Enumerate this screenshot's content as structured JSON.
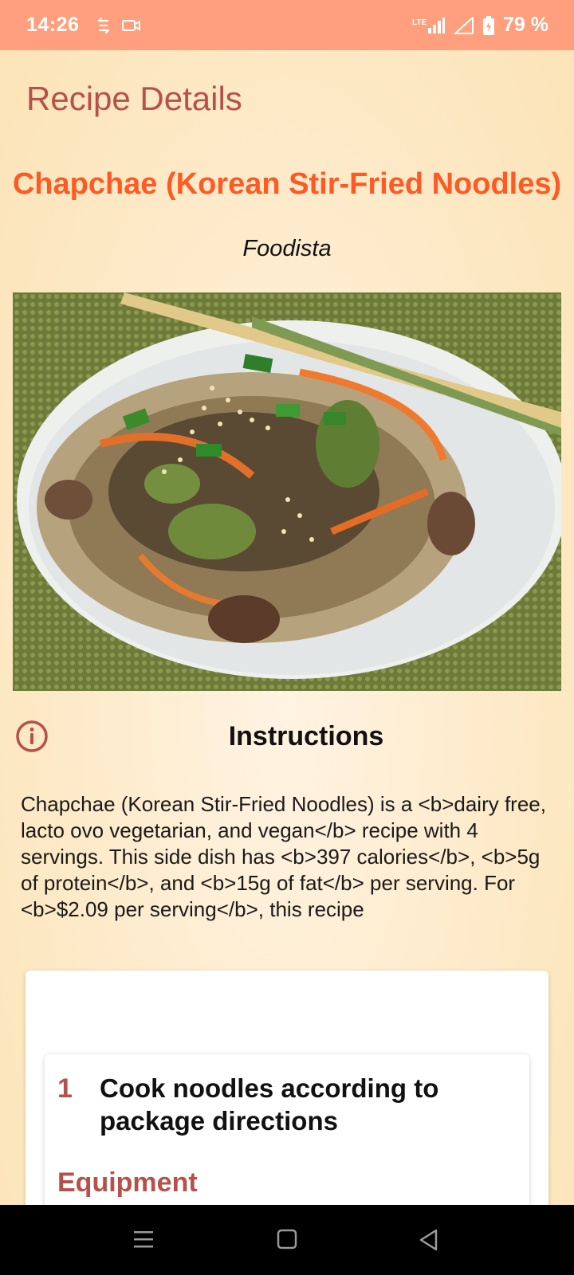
{
  "status_bar": {
    "time": "14:26",
    "battery": "79 %",
    "icons": [
      "sync-icon",
      "video-icon",
      "lte-signal-icon",
      "signal-icon",
      "battery-icon"
    ]
  },
  "app": {
    "title": "Recipe Details"
  },
  "recipe": {
    "title": "Chapchae (Korean Stir-Fried Noodles)",
    "source": "Foodista",
    "image_icon": "recipe-photo"
  },
  "instructions": {
    "heading": "Instructions",
    "summary": "Chapchae (Korean Stir-Fried Noodles) is a <b>dairy free, lacto ovo vegetarian, and vegan</b> recipe with 4 servings. This side dish has <b>397 calories</b>, <b>5g of protein</b>, and <b>15g of fat</b> per serving. For <b>$2.09 per serving</b>, this recipe"
  },
  "steps": [
    {
      "number": "1",
      "text": "Cook noodles according to package directions",
      "equipment_label": "Equipment"
    }
  ],
  "colors": {
    "status_bar": "#ff9f7d",
    "accent": "#b5504a",
    "title": "#ff5a26",
    "background": "#fde9c6"
  },
  "nav_bar": {
    "icons": [
      "menu-icon",
      "home-icon",
      "back-icon"
    ]
  }
}
